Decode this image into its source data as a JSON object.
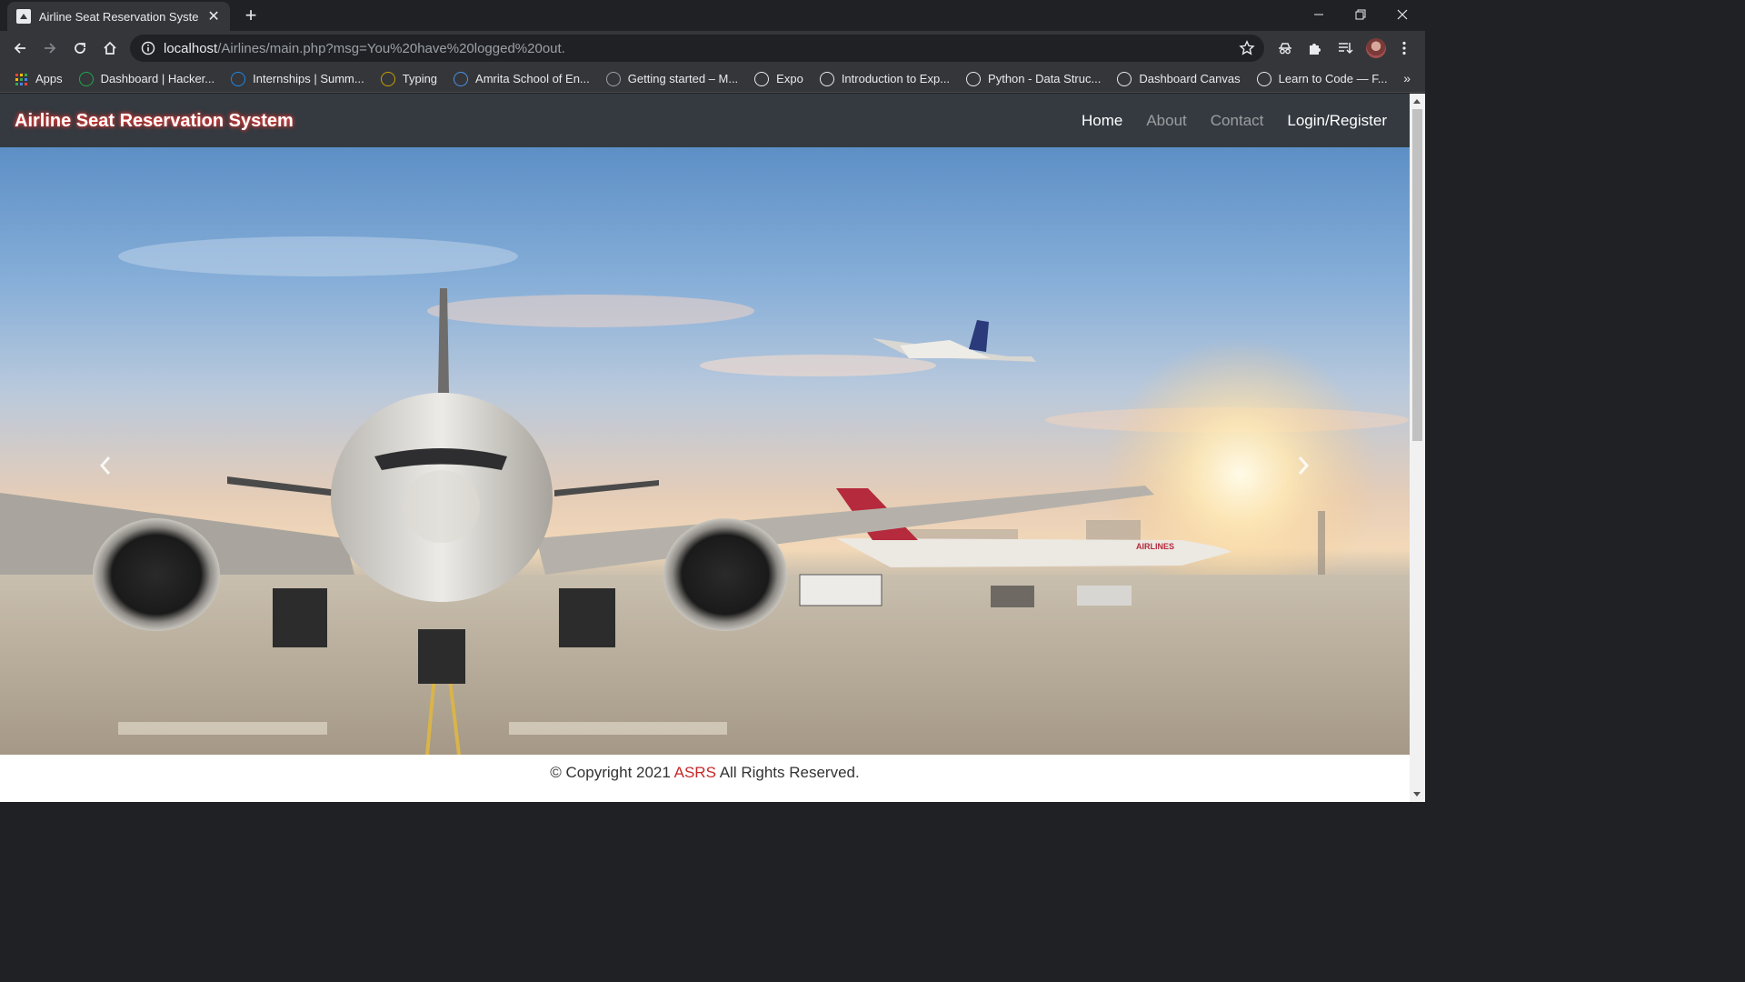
{
  "browser": {
    "tab_title": "Airline Seat Reservation System |",
    "url_host": "localhost",
    "url_path": "/Airlines/main.php?msg=You%20have%20logged%20out.",
    "bookmarks": [
      {
        "label": "Apps",
        "icon": "apps-grid-icon",
        "color": "#4285f4"
      },
      {
        "label": "Dashboard | Hacker...",
        "icon": "hackerrank-icon",
        "color": "#1ba94c"
      },
      {
        "label": "Internships | Summ...",
        "icon": "internshala-icon",
        "color": "#1e88e5"
      },
      {
        "label": "Typing",
        "icon": "typing-icon",
        "color": "#c5a100"
      },
      {
        "label": "Amrita School of En...",
        "icon": "amrita-icon",
        "color": "#4a90e2"
      },
      {
        "label": "Getting started – M...",
        "icon": "globe-icon",
        "color": "#9aa0a6"
      },
      {
        "label": "Expo",
        "icon": "expo-icon",
        "color": "#e8eaed"
      },
      {
        "label": "Introduction to Exp...",
        "icon": "intro-icon",
        "color": "#e8eaed"
      },
      {
        "label": "Python - Data Struc...",
        "icon": "python-icon",
        "color": "#e8eaed"
      },
      {
        "label": "Dashboard Canvas",
        "icon": "aws-icon",
        "color": "#e8eaed"
      },
      {
        "label": "Learn to Code — F...",
        "icon": "freecodecamp-icon",
        "color": "#e8eaed"
      }
    ],
    "more": "»"
  },
  "site": {
    "brand": "Airline Seat Reservation System",
    "nav": [
      {
        "label": "Home",
        "state": "active"
      },
      {
        "label": "About",
        "state": "muted"
      },
      {
        "label": "Contact",
        "state": "muted"
      },
      {
        "label": "Login/Register",
        "state": "bright"
      }
    ],
    "footer": {
      "prefix": "© Copyright 2021 ",
      "brand": "ASRS",
      "suffix": " All Rights Reserved."
    }
  },
  "colors": {
    "navbar": "#343a40",
    "brand_glow": "#e53935",
    "footer_brand": "#c62828"
  }
}
